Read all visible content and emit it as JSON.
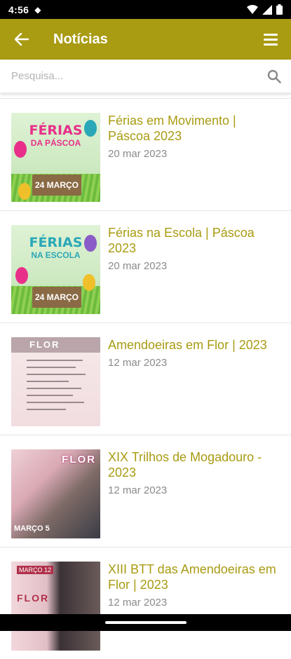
{
  "status": {
    "time": "4:56"
  },
  "appbar": {
    "title": "Notícias",
    "back_icon": "arrow-left-icon",
    "menu_icon": "hamburger-menu-icon"
  },
  "search": {
    "placeholder": "Pesquisa...",
    "icon": "search-icon"
  },
  "news": [
    {
      "title": "Férias em Movimento | Páscoa 2023",
      "date": "20 mar 2023",
      "thumb": {
        "heading": "FÉRIAS",
        "sub": "DA PÁSCOA",
        "sign": "24 MARÇO"
      }
    },
    {
      "title": "Férias na Escola | Páscoa 2023",
      "date": "20 mar 2023",
      "thumb": {
        "heading": "FÉRIAS",
        "sub": "NA ESCOLA",
        "sign": "24 MARÇO"
      }
    },
    {
      "title": "Amendoeiras em Flor | 2023",
      "date": "12 mar 2023",
      "thumb": {
        "heading": "FLOR"
      }
    },
    {
      "title": "XIX Trilhos de Mogadouro - 2023",
      "date": "12 mar 2023",
      "thumb": {
        "heading": "FLOR",
        "footer": "MARÇO 5"
      }
    },
    {
      "title": "XIII BTT das Amendoeiras em Flor | 2023",
      "date": "12 mar 2023",
      "thumb": {
        "heading": "FLOR",
        "footer": "MARÇO 12"
      }
    }
  ],
  "colors": {
    "accent": "#a99b12",
    "date": "#8a8a8a"
  }
}
